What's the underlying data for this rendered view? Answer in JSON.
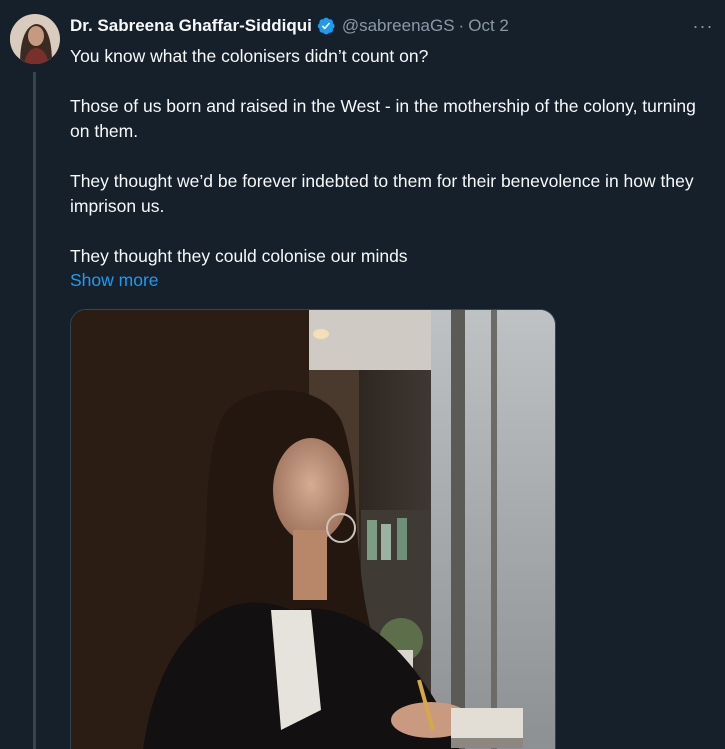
{
  "author": {
    "name": "Dr. Sabreena Ghaffar-Siddiqui",
    "handle": "@sabreenaGS",
    "separator": "·",
    "date": "Oct 2",
    "verified_icon": "verified-badge-icon"
  },
  "more_icon": "more-horizontal-icon",
  "more_glyph": "···",
  "tweet": {
    "paragraphs": [
      "You know what the colonisers didn’t count on?",
      "Those of us born and raised in the West - in the mothership of the colony, turning on them.",
      "They thought we’d be forever indebted to them for their benevolence in how they imprison us.",
      "They thought they could colonise our minds"
    ],
    "show_more": "Show more"
  },
  "media": {
    "type": "photo"
  },
  "colors": {
    "background": "#15202b",
    "text": "#f7f9f9",
    "secondary": "#8b98a5",
    "link": "#1d9bf0",
    "verified": "#1d9bf0"
  }
}
